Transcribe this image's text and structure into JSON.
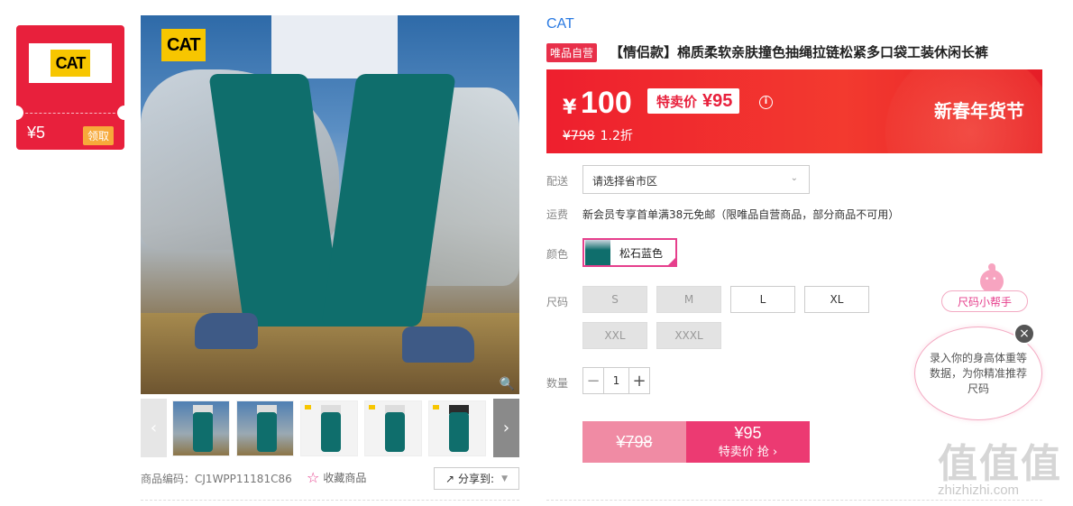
{
  "coupon": {
    "logo_text": "CAT",
    "amount": "¥5",
    "claim_label": "领取"
  },
  "gallery": {
    "photo_logo_text": "CAT",
    "zoom_icon": "search-icon",
    "thumbnails": [
      "thumb-1",
      "thumb-2",
      "thumb-3",
      "thumb-4",
      "thumb-5",
      "thumb-6"
    ],
    "product_code_label": "商品编码：",
    "product_code": "CJ1WPP11181C86",
    "favorite_label": "收藏商品",
    "share_label": "分享到:"
  },
  "product": {
    "brand": "CAT",
    "self_operated_tag": "唯品自营",
    "title": "【情侣款】棉质柔软亲肤撞色抽绳拉链松紧多口袋工装休闲长裤"
  },
  "price": {
    "currency": "¥",
    "price": "100",
    "special_label": "特卖价",
    "special_price": "¥95",
    "original_price": "¥798",
    "discount": "1.2折",
    "festival": "新春年货节",
    "colors": {
      "banner": "#ee1f2e",
      "accent": "#e63f8c"
    }
  },
  "delivery": {
    "label": "配送",
    "placeholder": "请选择省市区"
  },
  "shipping": {
    "label": "运费",
    "text": "新会员专享首单满38元免邮（限唯品自营商品，部分商品不可用）"
  },
  "color": {
    "label": "颜色",
    "selected": "松石蓝色"
  },
  "sizes": {
    "label": "尺码",
    "options": [
      {
        "label": "S",
        "available": false
      },
      {
        "label": "M",
        "available": false
      },
      {
        "label": "L",
        "available": true
      },
      {
        "label": "XL",
        "available": true
      },
      {
        "label": "XXL",
        "available": false
      },
      {
        "label": "XXXL",
        "available": false
      }
    ]
  },
  "quantity": {
    "label": "数量",
    "value": "1",
    "minus": "−",
    "plus": "+"
  },
  "buy": {
    "original": "¥798",
    "price": "¥95",
    "action": "特卖价 抢 ›"
  },
  "size_helper": {
    "button_label": "尺码小帮手",
    "bubble_text": "录入你的身高体重等数据，为你精准推荐尺码",
    "close_icon": "×"
  },
  "watermark": {
    "text": "值值值",
    "url": "zhizhizhi.com"
  }
}
